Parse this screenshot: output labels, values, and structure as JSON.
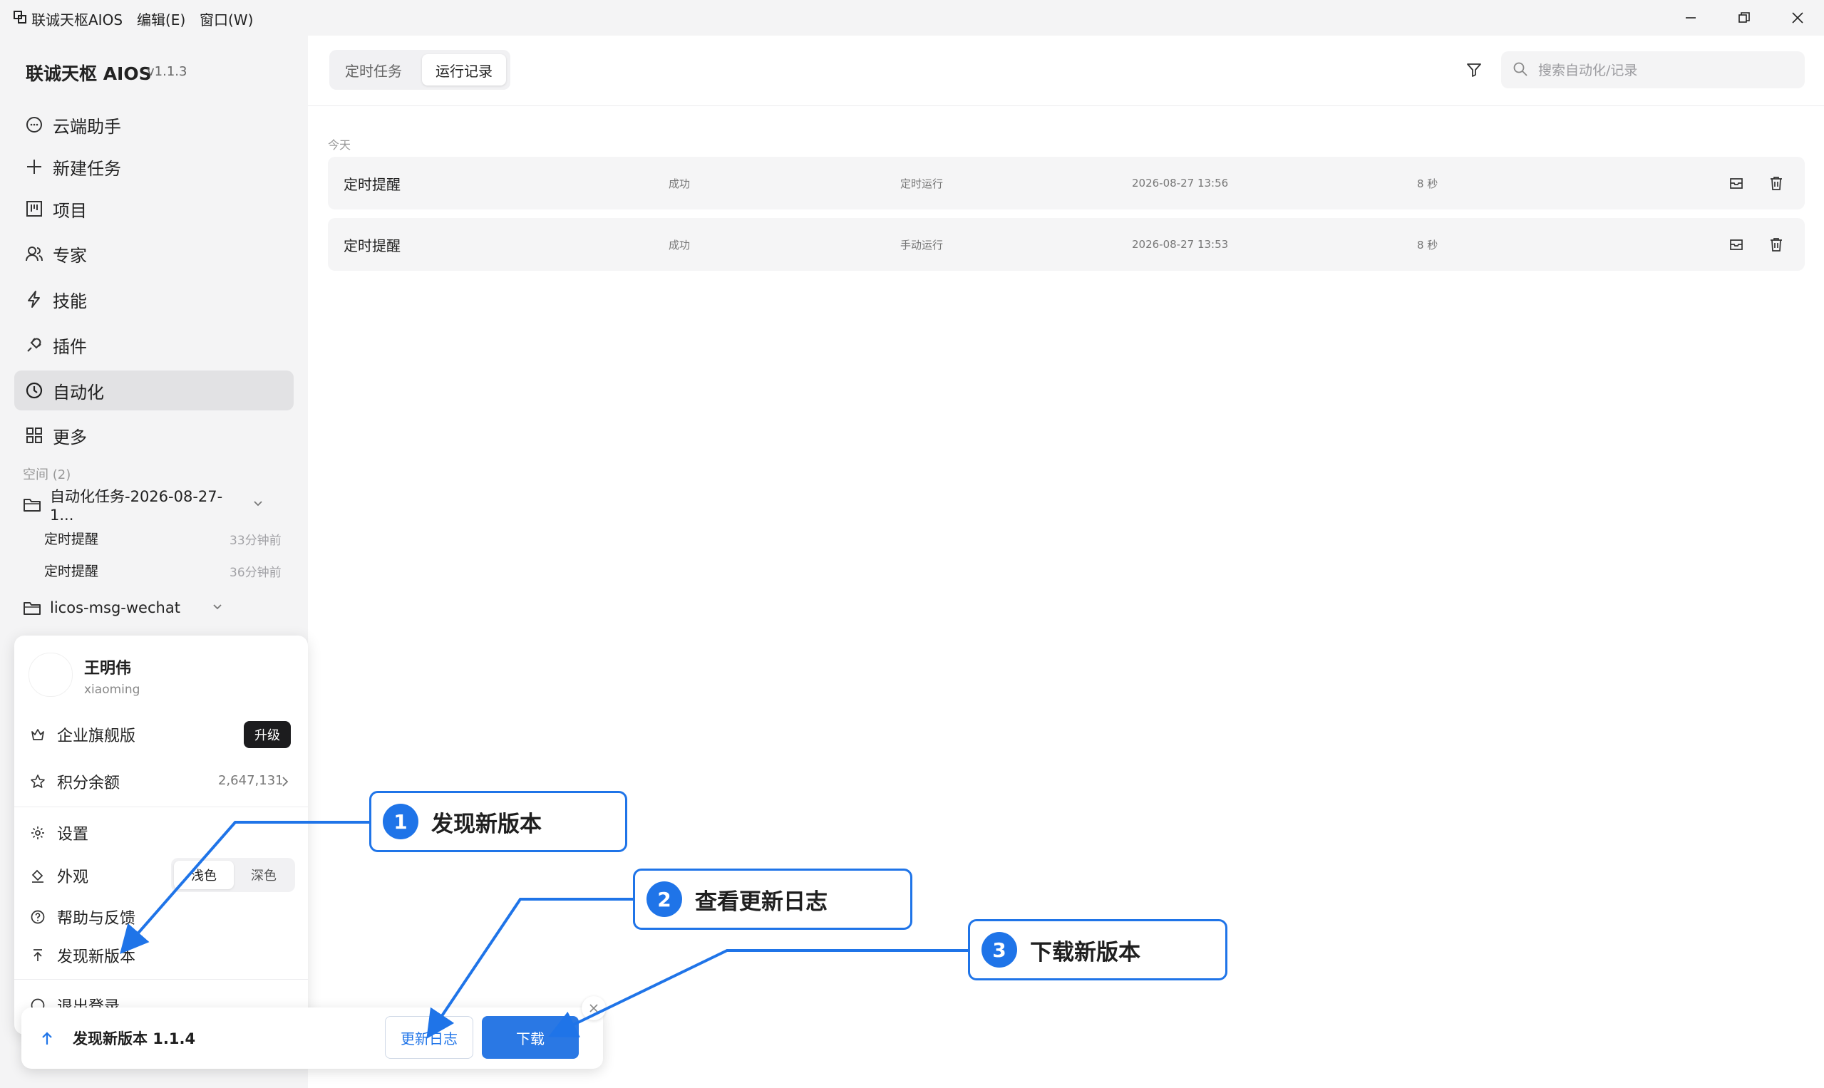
{
  "titlebar": {
    "app_name": "联诚天枢AIOS",
    "menus": [
      "编辑(E)",
      "窗口(W)"
    ]
  },
  "sidebar": {
    "brand": "联诚天枢 AIOS",
    "version": "v1.1.3",
    "nav": [
      {
        "label": "云端助手",
        "icon": "chat-bubble-icon"
      },
      {
        "label": "新建任务",
        "icon": "plus-icon"
      },
      {
        "label": "项目",
        "icon": "kanban-icon"
      },
      {
        "label": "专家",
        "icon": "people-icon"
      },
      {
        "label": "技能",
        "icon": "lightning-icon"
      },
      {
        "label": "插件",
        "icon": "plug-icon"
      },
      {
        "label": "自动化",
        "icon": "clock-icon",
        "active": true
      },
      {
        "label": "更多",
        "icon": "grid-icon"
      }
    ],
    "spaces_header": "空间 (2)",
    "spaces": [
      {
        "name": "自动化任务-2026-08-27-1...",
        "items": [
          {
            "label": "定时提醒",
            "time": "33分钟前"
          },
          {
            "label": "定时提醒",
            "time": "36分钟前"
          }
        ]
      },
      {
        "name": "licos-msg-wechat",
        "items": []
      }
    ]
  },
  "main": {
    "tabs": [
      {
        "label": "定时任务",
        "active": false
      },
      {
        "label": "运行记录",
        "active": true
      }
    ],
    "search_placeholder": "搜索自动化/记录",
    "section_label": "今天",
    "rows": [
      {
        "name": "定时提醒",
        "status": "成功",
        "trigger": "定时运行",
        "time": "2026-08-27 13:56",
        "duration": "8 秒"
      },
      {
        "name": "定时提醒",
        "status": "成功",
        "trigger": "手动运行",
        "time": "2026-08-27 13:53",
        "duration": "8 秒"
      }
    ]
  },
  "user_menu": {
    "username": "王明伟",
    "account": "xiaoming",
    "plan_label": "企业旗舰版",
    "upgrade_label": "升级",
    "points_label": "积分余额",
    "points_value": "2,647,131",
    "settings_label": "设置",
    "appearance_label": "外观",
    "theme_light": "浅色",
    "theme_dark": "深色",
    "help_label": "帮助与反馈",
    "new_version_label": "发现新版本",
    "logout_label": "退出登录"
  },
  "update_bar": {
    "message": "发现新版本 1.1.4",
    "changelog_label": "更新日志",
    "download_label": "下载"
  },
  "callouts": [
    {
      "num": "1",
      "text": "发现新版本"
    },
    {
      "num": "2",
      "text": "查看更新日志"
    },
    {
      "num": "3",
      "text": "下载新版本"
    }
  ],
  "colors": {
    "accent": "#1f74e8",
    "sidebar_bg": "#f4f4f5",
    "active_nav": "#e2e2e4"
  }
}
